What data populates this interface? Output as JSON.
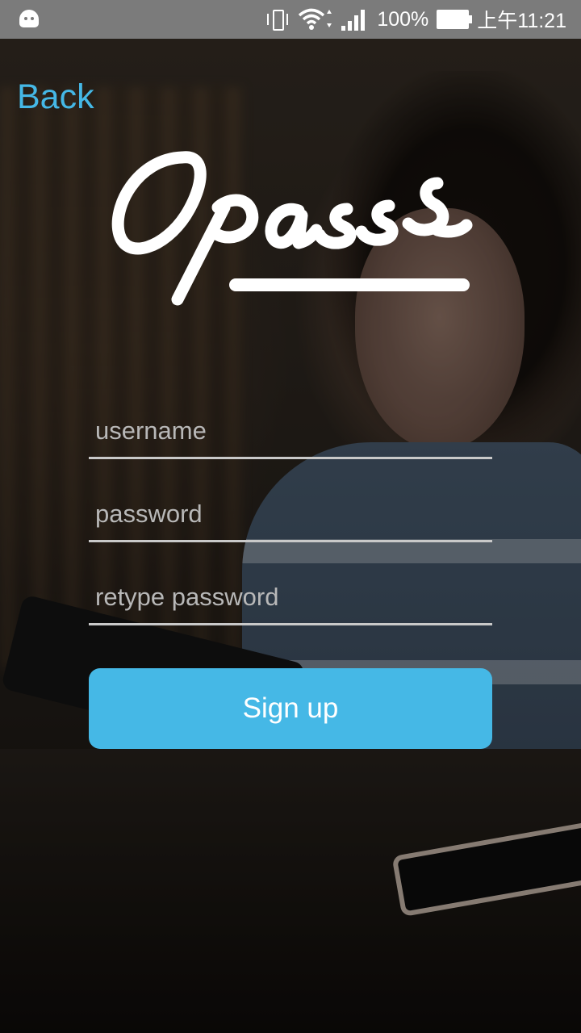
{
  "status_bar": {
    "battery_percent": "100%",
    "time": "上午11:21",
    "icons": [
      "android-icon",
      "vibrate-icon",
      "wifi-icon",
      "signal-icon",
      "battery-icon"
    ]
  },
  "nav": {
    "back_label": "Back"
  },
  "logo": {
    "text": "Opass"
  },
  "form": {
    "username_placeholder": "username",
    "password_placeholder": "password",
    "retype_password_placeholder": "retype password",
    "signup_label": "Sign up"
  },
  "colors": {
    "accent": "#45b8e6",
    "status_bar": "#7b7b7b",
    "field_line": "#c9c9c9"
  }
}
